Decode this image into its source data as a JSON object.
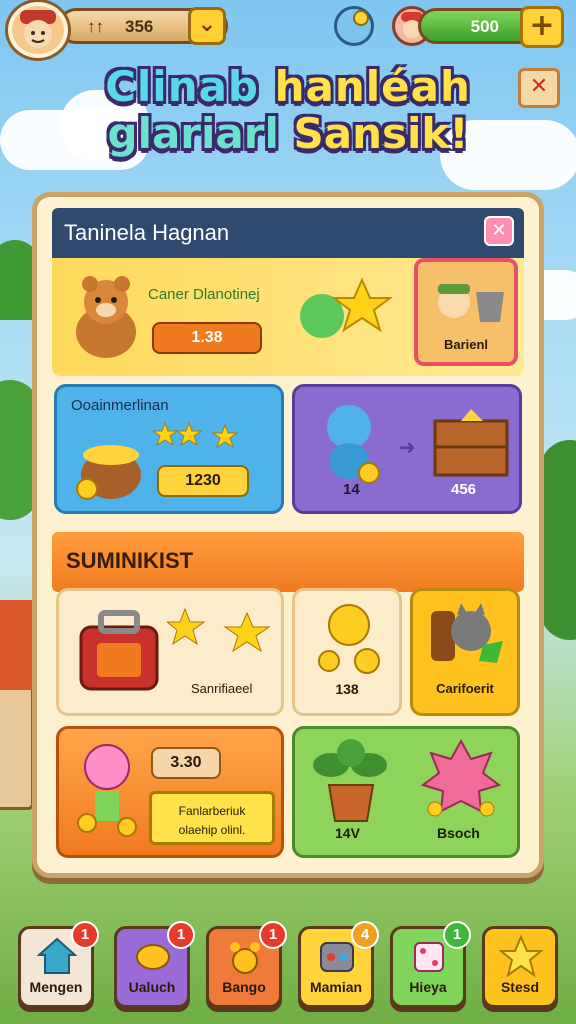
{
  "top_bar": {
    "coin_prefix": "↑↑",
    "coin_value": "356",
    "dropdown_icon": "chevron-down-icon",
    "gem_value": "500",
    "add_icon": "plus-icon"
  },
  "title": {
    "line1_a": "Clinab",
    "line1_b": "hanléah",
    "line2_a": "glariarl",
    "line2_b": "Sansik!"
  },
  "close_symbol": "✕",
  "panel": {
    "title": "Taninela Hagnan",
    "close_symbol": "✕",
    "card1": {
      "caption": "Caner Dlanotinej",
      "price": "1.38",
      "featured_label": "Barienl"
    },
    "card2": {
      "title": "Ooainmerlinan",
      "price": "1230"
    },
    "card3": {
      "left_value": "14",
      "right_value": "456"
    }
  },
  "section": {
    "title": "SUMINIKIST",
    "item1_label": "Sanrifiaeel",
    "item2_label": "138",
    "item3_label": "Carifoerit",
    "item4_price": "3.30",
    "item4_button": "Fanlarberiuk olaehip olinl.",
    "item5_label": "14V",
    "item6_label": "Bsoch"
  },
  "nav": [
    {
      "label": "Mengen",
      "badge": "1",
      "icon": "house-icon",
      "color": "#f4e6d4"
    },
    {
      "label": "Ualuch",
      "badge": "1",
      "icon": "leaf-icon",
      "color": "#9a6bd6"
    },
    {
      "label": "Bango",
      "badge": "1",
      "icon": "paw-icon",
      "color": "#f07a3a"
    },
    {
      "label": "Mamian",
      "badge": "4",
      "icon": "potion-icon",
      "color": "#ffd43a"
    },
    {
      "label": "Hieya",
      "badge": "1",
      "icon": "dice-icon",
      "color": "#7fd45a"
    },
    {
      "label": "Stesd",
      "badge": "",
      "icon": "star-icon",
      "color": "#ffc21f"
    }
  ],
  "colors": {
    "header": "#2f4a6e",
    "section": "#f07a1f",
    "board": "#fdf1cf"
  }
}
